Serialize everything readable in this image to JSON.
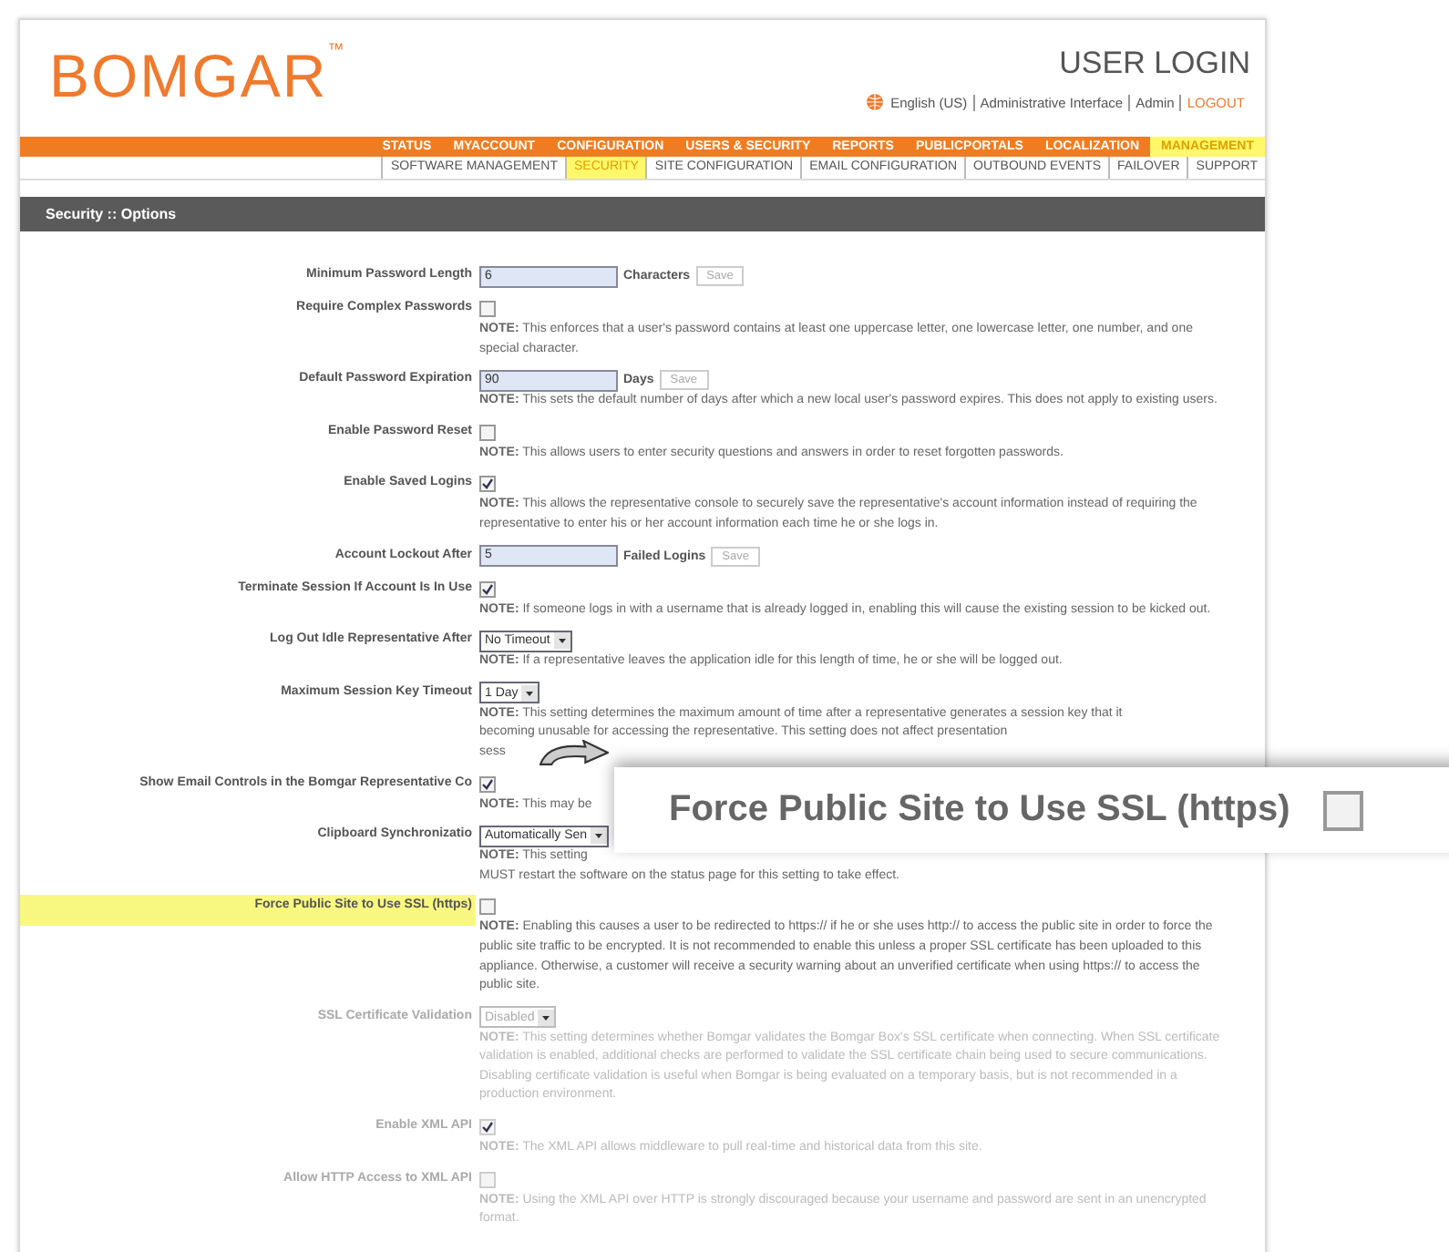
{
  "header": {
    "logo": "BOMGAR$^{™}$",
    "title": "USER LOGIN",
    "links": [
      {
        "text": "English (US)",
        "kind": "language"
      },
      {
        "text": "Administrative Interface",
        "kind": "plain"
      },
      {
        "text": "Admin",
        "kind": "plain"
      },
      {
        "text": "LOGOUT",
        "kind": "logout"
      }
    ]
  },
  "nav": [
    {
      "label": "STATUS",
      "selected": false
    },
    {
      "label": "MYACCOUNT",
      "selected": false
    },
    {
      "label": "CONFIGURATION",
      "selected": false
    },
    {
      "label": "USERS & SECURITY",
      "selected": false
    },
    {
      "label": "REPORTS",
      "selected": false
    },
    {
      "label": "PUBLICPORTALS",
      "selected": false
    },
    {
      "label": "LOCALIZATION",
      "selected": false
    },
    {
      "label": "MANAGEMENT",
      "selected": true
    }
  ],
  "subnav": [
    {
      "label": "SOFTWARE MANAGEMENT",
      "selected": false
    },
    {
      "label": "SECURITY",
      "selected": true
    },
    {
      "label": "SITE CONFIGURATION",
      "selected": false
    },
    {
      "label": "EMAIL CONFIGURATION",
      "selected": false
    },
    {
      "label": "OUTBOUND EVENTS",
      "selected": false
    },
    {
      "label": "FAILOVER",
      "selected": false
    },
    {
      "label": "SUPPORT",
      "selected": false
    }
  ],
  "section_title": "Security :: Options",
  "settings": [
    {
      "label": "Minimum Password Length",
      "kind": "text",
      "value": "6",
      "unit": "Characters",
      "button": "Save"
    },
    {
      "label": "Require Complex Passwords",
      "kind": "checkbox",
      "checked": false,
      "notes": [
        "**NOTE:** This enforces that a user's password contains at least one uppercase letter, one lowercase letter, one number, and one special character."
      ]
    },
    {
      "label": "Default Password Expiration",
      "kind": "text",
      "value": "90",
      "unit": "Days",
      "button": "Save",
      "notes": [
        "**NOTE:** This sets the default number of days after which a new local user's password expires. This does not apply to existing users."
      ]
    },
    {
      "label": "Enable Password Reset",
      "kind": "checkbox",
      "checked": false,
      "notes": [
        "**NOTE:** This allows users to enter security questions and answers in order to reset forgotten passwords."
      ]
    },
    {
      "label": "Enable Saved Logins",
      "kind": "checkbox",
      "checked": true,
      "notes": [
        "**NOTE:** This allows the representative console to securely save the representative's account information instead of requiring the representative to enter his or her account information each time he or she logs in."
      ]
    },
    {
      "label": "Account Lockout After",
      "kind": "text",
      "value": "5",
      "unit": "Failed Logins",
      "button": "Save"
    },
    {
      "label": "Terminate Session If Account Is In Use",
      "kind": "checkbox",
      "checked": true,
      "notes": [
        "**NOTE:** If someone logs in with a username that is already logged in, enabling this will cause the existing session to be kicked out."
      ]
    },
    {
      "label": "Log Out Idle Representative After",
      "kind": "select",
      "value": "No Timeout",
      "notes": [
        "**NOTE:** If a representative leaves the application idle for this length of time, he or she will be logged out."
      ]
    },
    {
      "label": "Maximum Session Key Timeout",
      "kind": "select",
      "value": "1 Day",
      "notes": [
        "**NOTE:** This setting determines the maximum amount of time after a representative generates a session key that it",
        "becoming unusable for accessing the representative. This setting does not affect presentation",
        "sess"
      ]
    },
    {
      "label": "Show Email Controls in the Bomgar Representative Co",
      "kind": "checkbox",
      "checked": true,
      "notes": [
        "**NOTE:** This may be"
      ]
    },
    {
      "label": "Clipboard Synchronizatio",
      "kind": "select",
      "value": "Automatically Sen",
      "notes": [
        "**NOTE:** This setting",
        "MUST restart the software on the status page for this setting to take effect."
      ]
    },
    {
      "label": "Force Public Site to Use SSL (https)",
      "kind": "checkbox",
      "checked": false,
      "highlighted": true,
      "notes": [
        "**NOTE:** Enabling this causes a user to be redirected to https:// if he or she uses http:// to access the public site in order to force the public site traffic to be encrypted. It is not recommended to enable this unless a proper SSL certificate has been uploaded to this appliance. Otherwise, a customer will receive a security warning about an unverified certificate when using https:// to access the public site."
      ]
    },
    {
      "label": "SSL Certificate Validation",
      "kind": "select",
      "value": "Disabled",
      "faded": true,
      "notes": [
        "**NOTE:** This setting determines whether Bomgar validates the Bomgar Box's SSL certificate when connecting. When SSL certificate validation is enabled, additional checks are performed to validate the SSL certificate chain being used to secure communications. Disabling certificate validation is useful when Bomgar is being evaluated on a temporary basis, but is not recommended in a production environment."
      ]
    },
    {
      "label": "Enable XML API",
      "kind": "checkbox",
      "checked": true,
      "faded": true,
      "notes": [
        "**NOTE:** The XML API allows middleware to pull real-time and historical data from this site."
      ]
    },
    {
      "label": "Allow HTTP Access to XML API",
      "kind": "checkbox",
      "checked": false,
      "faded": true,
      "notes": [
        "**NOTE:** Using the XML API over HTTP is strongly discouraged because your username and password are sent in an unencrypted format."
      ]
    }
  ],
  "callout": {
    "label": "Force Public Site to Use SSL (https)",
    "checked": false
  }
}
